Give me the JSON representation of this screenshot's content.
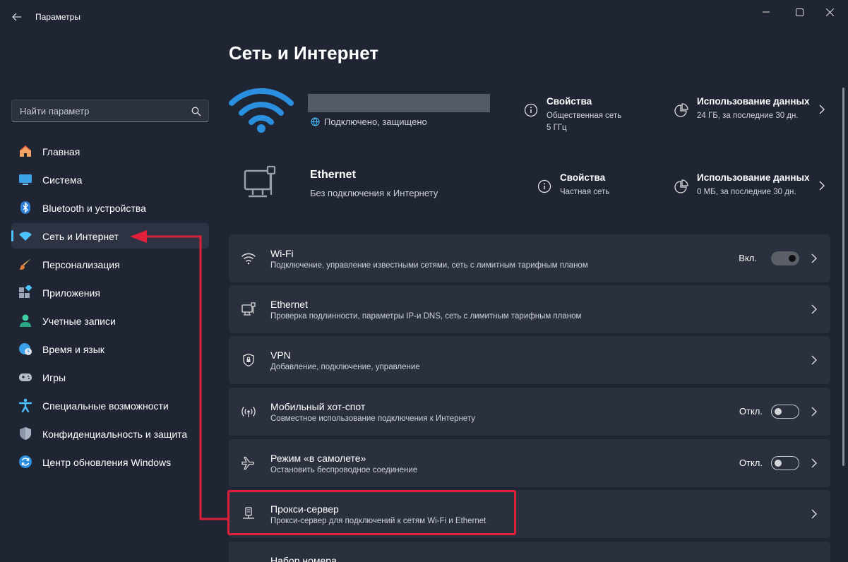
{
  "window": {
    "title": "Параметры"
  },
  "search": {
    "placeholder": "Найти параметр"
  },
  "sidebar": {
    "items": [
      {
        "label": "Главная",
        "icon": "home-icon"
      },
      {
        "label": "Система",
        "icon": "monitor-icon"
      },
      {
        "label": "Bluetooth и устройства",
        "icon": "bluetooth-icon"
      },
      {
        "label": "Сеть и Интернет",
        "icon": "wifi-icon",
        "active": true
      },
      {
        "label": "Персонализация",
        "icon": "brush-icon"
      },
      {
        "label": "Приложения",
        "icon": "apps-icon"
      },
      {
        "label": "Учетные записи",
        "icon": "person-icon"
      },
      {
        "label": "Время и язык",
        "icon": "globe-clock-icon"
      },
      {
        "label": "Игры",
        "icon": "gamepad-icon"
      },
      {
        "label": "Специальные возможности",
        "icon": "accessibility-icon"
      },
      {
        "label": "Конфиденциальность и защита",
        "icon": "shield-icon"
      },
      {
        "label": "Центр обновления Windows",
        "icon": "update-icon"
      }
    ]
  },
  "page": {
    "title": "Сеть и Интернет"
  },
  "wifi_hero": {
    "status": "Подключено, защищено",
    "properties": {
      "title": "Свойства",
      "line1": "Общественная сеть",
      "line2": "5 ГГц"
    },
    "usage": {
      "title": "Использование данных",
      "line1": "24 ГБ, за последние 30 дн."
    }
  },
  "ethernet_hero": {
    "name": "Ethernet",
    "status": "Без подключения к Интернету",
    "properties": {
      "title": "Свойства",
      "line1": "Частная сеть"
    },
    "usage": {
      "title": "Использование данных",
      "line1": "0 МБ, за последние 30 дн."
    }
  },
  "cards": [
    {
      "title": "Wi-Fi",
      "subtitle": "Подключение, управление известными сетями, сеть с лимитным тарифным планом",
      "toggle_label": "Вкл.",
      "toggle_on": true,
      "icon": "wifi-icon"
    },
    {
      "title": "Ethernet",
      "subtitle": "Проверка подлинности, параметры IP-и DNS, сеть с лимитным тарифным планом",
      "icon": "ethernet-icon"
    },
    {
      "title": "VPN",
      "subtitle": "Добавление, подключение, управление",
      "icon": "vpn-shield-icon"
    },
    {
      "title": "Мобильный хот-спот",
      "subtitle": "Совместное использование подключения к Интернету",
      "toggle_label": "Откл.",
      "toggle_on": false,
      "icon": "hotspot-icon"
    },
    {
      "title": "Режим «в самолете»",
      "subtitle": "Остановить беспроводное соединение",
      "toggle_label": "Откл.",
      "toggle_on": false,
      "icon": "airplane-icon"
    },
    {
      "title": "Прокси-сервер",
      "subtitle": "Прокси-сервер для подключений к сетям Wi-Fi и Ethernet",
      "icon": "proxy-icon"
    },
    {
      "title": "Набор номера",
      "subtitle": "",
      "icon": "dialup-icon"
    }
  ],
  "colors": {
    "accent": "#4cc2ff",
    "highlight": "#e0203a",
    "background": "#1f2533",
    "card": "#2a303d"
  }
}
